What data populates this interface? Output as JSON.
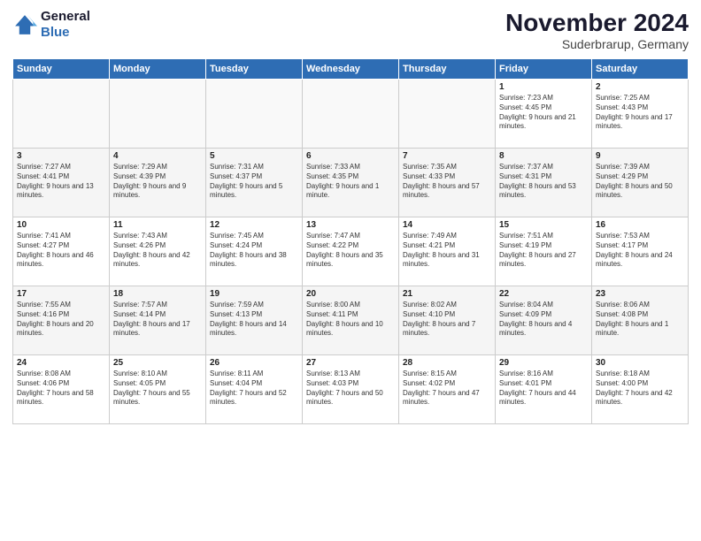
{
  "logo": {
    "line1": "General",
    "line2": "Blue"
  },
  "title": "November 2024",
  "location": "Suderbrarup, Germany",
  "headers": [
    "Sunday",
    "Monday",
    "Tuesday",
    "Wednesday",
    "Thursday",
    "Friday",
    "Saturday"
  ],
  "weeks": [
    [
      {
        "day": "",
        "sunrise": "",
        "sunset": "",
        "daylight": ""
      },
      {
        "day": "",
        "sunrise": "",
        "sunset": "",
        "daylight": ""
      },
      {
        "day": "",
        "sunrise": "",
        "sunset": "",
        "daylight": ""
      },
      {
        "day": "",
        "sunrise": "",
        "sunset": "",
        "daylight": ""
      },
      {
        "day": "",
        "sunrise": "",
        "sunset": "",
        "daylight": ""
      },
      {
        "day": "1",
        "sunrise": "Sunrise: 7:23 AM",
        "sunset": "Sunset: 4:45 PM",
        "daylight": "Daylight: 9 hours and 21 minutes."
      },
      {
        "day": "2",
        "sunrise": "Sunrise: 7:25 AM",
        "sunset": "Sunset: 4:43 PM",
        "daylight": "Daylight: 9 hours and 17 minutes."
      }
    ],
    [
      {
        "day": "3",
        "sunrise": "Sunrise: 7:27 AM",
        "sunset": "Sunset: 4:41 PM",
        "daylight": "Daylight: 9 hours and 13 minutes."
      },
      {
        "day": "4",
        "sunrise": "Sunrise: 7:29 AM",
        "sunset": "Sunset: 4:39 PM",
        "daylight": "Daylight: 9 hours and 9 minutes."
      },
      {
        "day": "5",
        "sunrise": "Sunrise: 7:31 AM",
        "sunset": "Sunset: 4:37 PM",
        "daylight": "Daylight: 9 hours and 5 minutes."
      },
      {
        "day": "6",
        "sunrise": "Sunrise: 7:33 AM",
        "sunset": "Sunset: 4:35 PM",
        "daylight": "Daylight: 9 hours and 1 minute."
      },
      {
        "day": "7",
        "sunrise": "Sunrise: 7:35 AM",
        "sunset": "Sunset: 4:33 PM",
        "daylight": "Daylight: 8 hours and 57 minutes."
      },
      {
        "day": "8",
        "sunrise": "Sunrise: 7:37 AM",
        "sunset": "Sunset: 4:31 PM",
        "daylight": "Daylight: 8 hours and 53 minutes."
      },
      {
        "day": "9",
        "sunrise": "Sunrise: 7:39 AM",
        "sunset": "Sunset: 4:29 PM",
        "daylight": "Daylight: 8 hours and 50 minutes."
      }
    ],
    [
      {
        "day": "10",
        "sunrise": "Sunrise: 7:41 AM",
        "sunset": "Sunset: 4:27 PM",
        "daylight": "Daylight: 8 hours and 46 minutes."
      },
      {
        "day": "11",
        "sunrise": "Sunrise: 7:43 AM",
        "sunset": "Sunset: 4:26 PM",
        "daylight": "Daylight: 8 hours and 42 minutes."
      },
      {
        "day": "12",
        "sunrise": "Sunrise: 7:45 AM",
        "sunset": "Sunset: 4:24 PM",
        "daylight": "Daylight: 8 hours and 38 minutes."
      },
      {
        "day": "13",
        "sunrise": "Sunrise: 7:47 AM",
        "sunset": "Sunset: 4:22 PM",
        "daylight": "Daylight: 8 hours and 35 minutes."
      },
      {
        "day": "14",
        "sunrise": "Sunrise: 7:49 AM",
        "sunset": "Sunset: 4:21 PM",
        "daylight": "Daylight: 8 hours and 31 minutes."
      },
      {
        "day": "15",
        "sunrise": "Sunrise: 7:51 AM",
        "sunset": "Sunset: 4:19 PM",
        "daylight": "Daylight: 8 hours and 27 minutes."
      },
      {
        "day": "16",
        "sunrise": "Sunrise: 7:53 AM",
        "sunset": "Sunset: 4:17 PM",
        "daylight": "Daylight: 8 hours and 24 minutes."
      }
    ],
    [
      {
        "day": "17",
        "sunrise": "Sunrise: 7:55 AM",
        "sunset": "Sunset: 4:16 PM",
        "daylight": "Daylight: 8 hours and 20 minutes."
      },
      {
        "day": "18",
        "sunrise": "Sunrise: 7:57 AM",
        "sunset": "Sunset: 4:14 PM",
        "daylight": "Daylight: 8 hours and 17 minutes."
      },
      {
        "day": "19",
        "sunrise": "Sunrise: 7:59 AM",
        "sunset": "Sunset: 4:13 PM",
        "daylight": "Daylight: 8 hours and 14 minutes."
      },
      {
        "day": "20",
        "sunrise": "Sunrise: 8:00 AM",
        "sunset": "Sunset: 4:11 PM",
        "daylight": "Daylight: 8 hours and 10 minutes."
      },
      {
        "day": "21",
        "sunrise": "Sunrise: 8:02 AM",
        "sunset": "Sunset: 4:10 PM",
        "daylight": "Daylight: 8 hours and 7 minutes."
      },
      {
        "day": "22",
        "sunrise": "Sunrise: 8:04 AM",
        "sunset": "Sunset: 4:09 PM",
        "daylight": "Daylight: 8 hours and 4 minutes."
      },
      {
        "day": "23",
        "sunrise": "Sunrise: 8:06 AM",
        "sunset": "Sunset: 4:08 PM",
        "daylight": "Daylight: 8 hours and 1 minute."
      }
    ],
    [
      {
        "day": "24",
        "sunrise": "Sunrise: 8:08 AM",
        "sunset": "Sunset: 4:06 PM",
        "daylight": "Daylight: 7 hours and 58 minutes."
      },
      {
        "day": "25",
        "sunrise": "Sunrise: 8:10 AM",
        "sunset": "Sunset: 4:05 PM",
        "daylight": "Daylight: 7 hours and 55 minutes."
      },
      {
        "day": "26",
        "sunrise": "Sunrise: 8:11 AM",
        "sunset": "Sunset: 4:04 PM",
        "daylight": "Daylight: 7 hours and 52 minutes."
      },
      {
        "day": "27",
        "sunrise": "Sunrise: 8:13 AM",
        "sunset": "Sunset: 4:03 PM",
        "daylight": "Daylight: 7 hours and 50 minutes."
      },
      {
        "day": "28",
        "sunrise": "Sunrise: 8:15 AM",
        "sunset": "Sunset: 4:02 PM",
        "daylight": "Daylight: 7 hours and 47 minutes."
      },
      {
        "day": "29",
        "sunrise": "Sunrise: 8:16 AM",
        "sunset": "Sunset: 4:01 PM",
        "daylight": "Daylight: 7 hours and 44 minutes."
      },
      {
        "day": "30",
        "sunrise": "Sunrise: 8:18 AM",
        "sunset": "Sunset: 4:00 PM",
        "daylight": "Daylight: 7 hours and 42 minutes."
      }
    ]
  ]
}
